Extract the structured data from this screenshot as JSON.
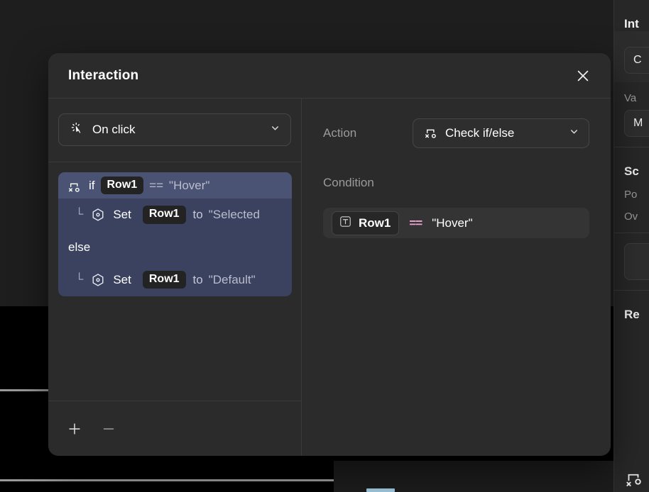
{
  "modal": {
    "title": "Interaction",
    "close_icon": "close-icon",
    "trigger": {
      "icon": "cursor-click-icon",
      "value": "On click",
      "chevron": "chevron-down-icon"
    },
    "steps": [
      {
        "id": "if",
        "icon": "branch-if-else-icon",
        "keyword": "if",
        "variable": "Row1",
        "operator": "==",
        "value": "\"Hover\"",
        "selected": true,
        "indent": false
      },
      {
        "id": "set-selected",
        "icon": "set-hex-icon",
        "elbow": "└",
        "keyword": "Set",
        "variable": "Row1",
        "connector": "to",
        "value": "\"Selected",
        "selected": false,
        "indent": true
      },
      {
        "id": "else",
        "keyword": "else",
        "selected": false,
        "indent": false
      },
      {
        "id": "set-default",
        "icon": "set-hex-icon",
        "elbow": "└",
        "keyword": "Set",
        "variable": "Row1",
        "connector": "to",
        "value": "\"Default\"",
        "selected": false,
        "indent": true
      }
    ],
    "footer": {
      "add_label": "+",
      "remove_label": "—"
    },
    "detail": {
      "action_label": "Action",
      "action_icon": "branch-if-else-icon",
      "action_value": "Check if/else",
      "action_chevron": "chevron-down-icon",
      "condition_label": "Condition",
      "condition": {
        "type_icon": "text-type-icon",
        "variable": "Row1",
        "operator": "==",
        "value": "\"Hover\""
      }
    }
  },
  "side_panel": {
    "title": "Int",
    "field_1": "C",
    "label_1": "Va",
    "field_2": "M",
    "title_2": "Sc",
    "label_2": "Po",
    "label_3": "Ov",
    "title_3": "Re",
    "bottom_icon": "branch-if-else-icon"
  },
  "colors": {
    "modal_bg": "#2b2b2b",
    "step_group_bg": "#3b4260",
    "step_selected_bg": "#4b5375",
    "accent_pink": "#eda6d4",
    "canvas_blue": "#9dc7dd"
  }
}
